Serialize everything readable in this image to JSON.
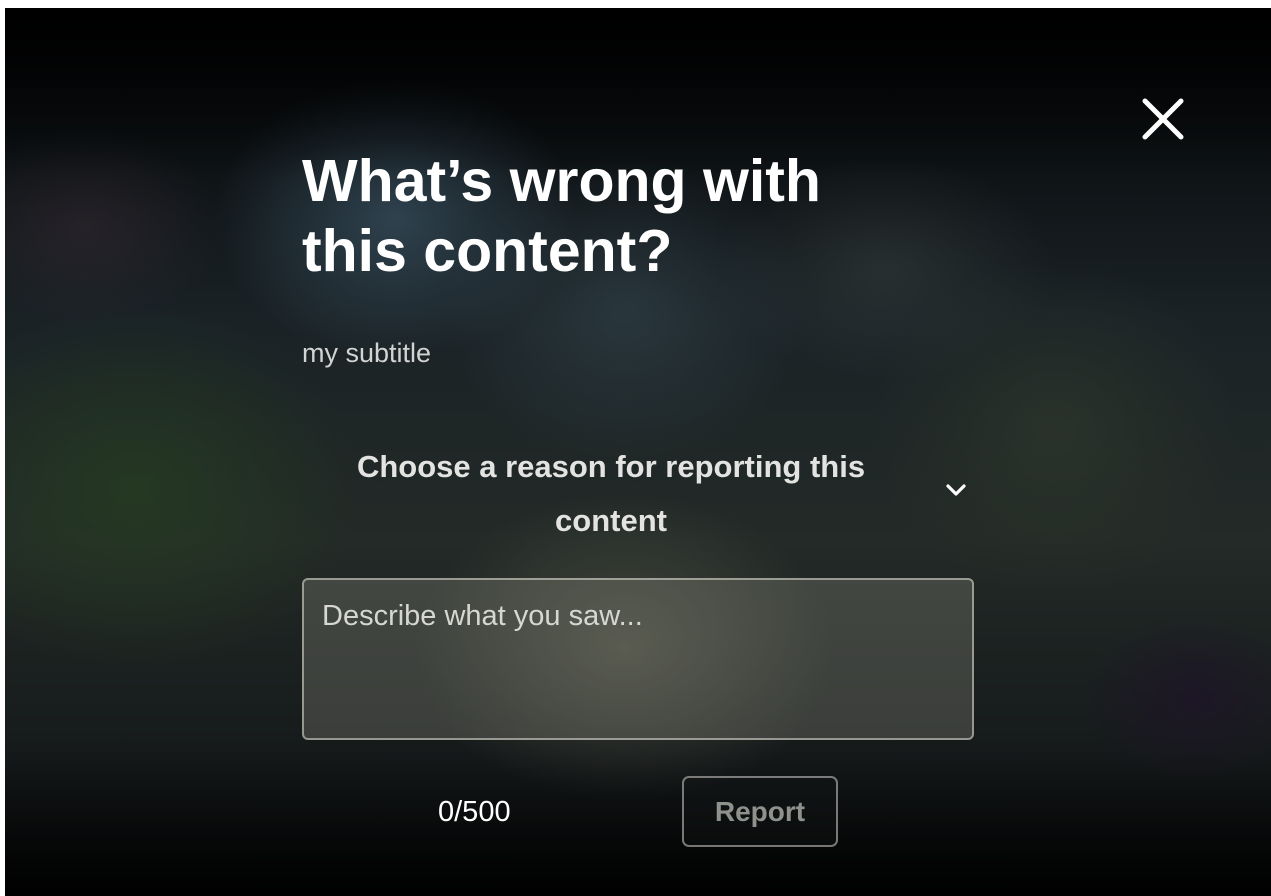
{
  "dialog": {
    "title": "What’s wrong with this content?",
    "subtitle": "my subtitle",
    "close_icon": "close-icon",
    "reason_select": {
      "selected_label": "Choose a reason for reporting this content",
      "icon": "chevron-down-icon"
    },
    "description": {
      "value": "",
      "placeholder": "Describe what you saw..."
    },
    "char_count": "0/500",
    "report_label": "Report"
  },
  "colors": {
    "text_primary": "#ffffff",
    "text_muted": "#d2d4d2",
    "button_disabled_text": "#8f918d",
    "field_border": "#dcdcd2"
  }
}
